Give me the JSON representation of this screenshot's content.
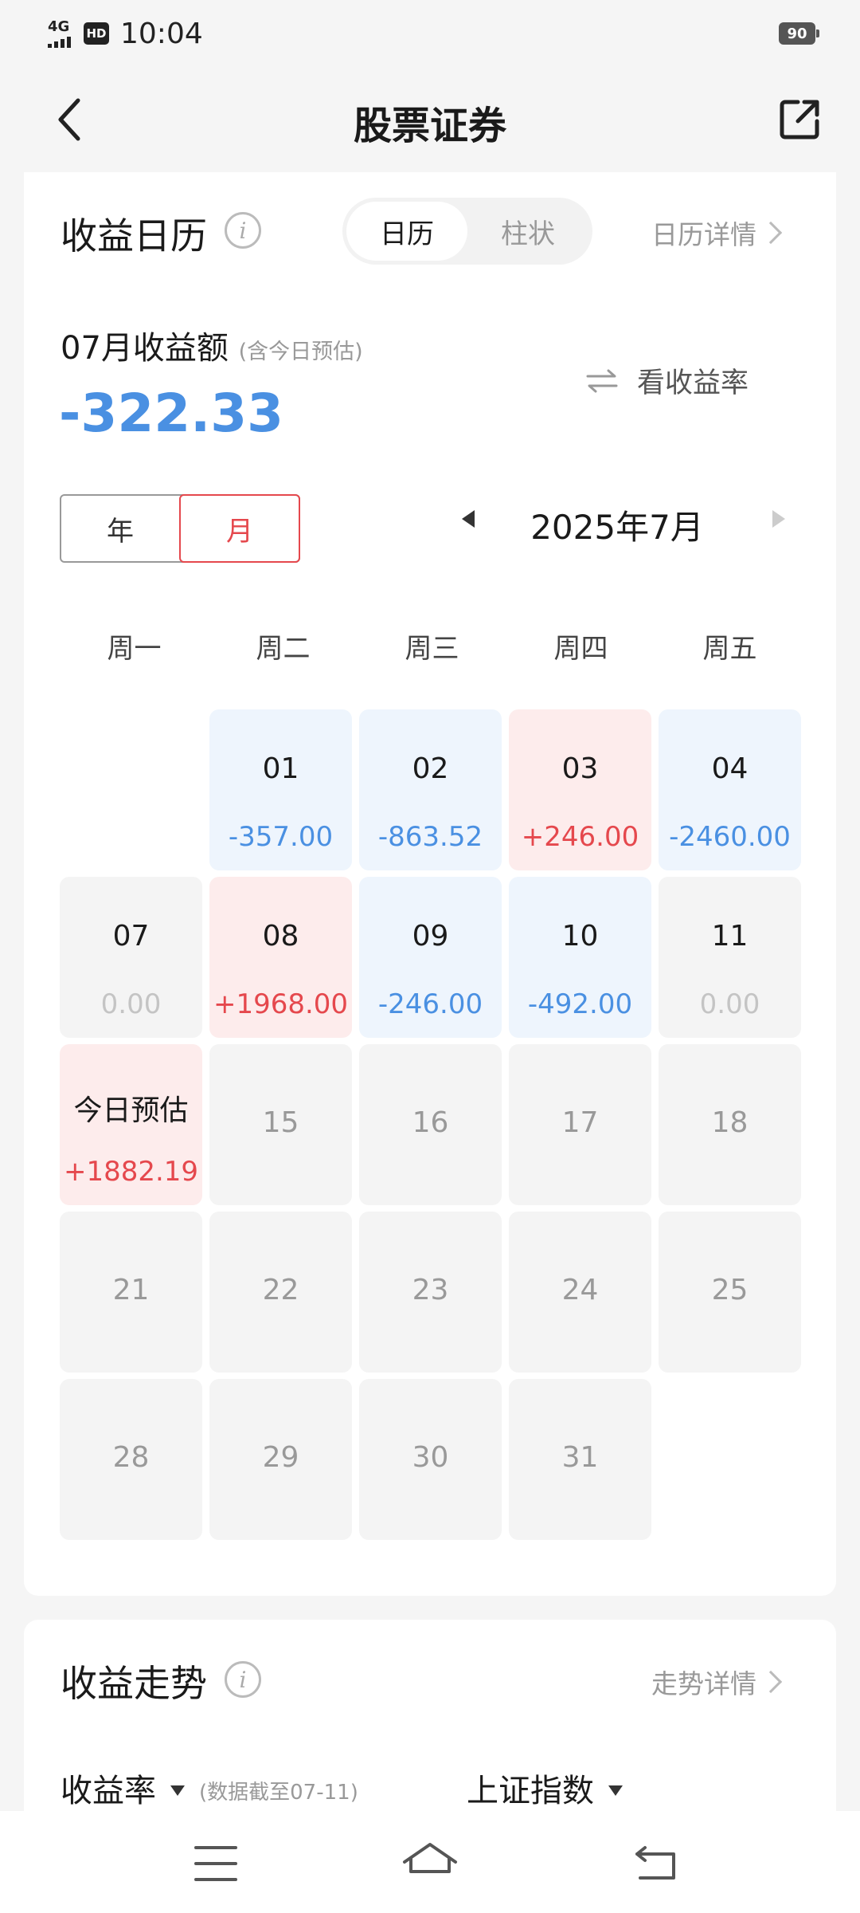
{
  "status": {
    "network": "4G",
    "hd": "HD",
    "time": "10:04",
    "battery": "90"
  },
  "nav": {
    "title": "股票证券"
  },
  "calendar_section": {
    "title": "收益日历",
    "info": "i",
    "tabs": [
      "日历",
      "柱状"
    ],
    "detail_link": "日历详情",
    "month_label": "07月收益额",
    "month_note": "(含今日预估)",
    "month_value": "-322.33",
    "toggle_label": "看收益率",
    "period_tabs": [
      "年",
      "月"
    ],
    "current_month": "2025年7月",
    "weekdays": [
      "周一",
      "周二",
      "周三",
      "周四",
      "周五"
    ],
    "rows": [
      [
        null,
        {
          "day": "01",
          "value": "-357.00",
          "kind": "blue"
        },
        {
          "day": "02",
          "value": "-863.52",
          "kind": "blue"
        },
        {
          "day": "03",
          "value": "+246.00",
          "kind": "red"
        },
        {
          "day": "04",
          "value": "-2460.00",
          "kind": "blue"
        }
      ],
      [
        {
          "day": "07",
          "value": "0.00",
          "kind": "gray"
        },
        {
          "day": "08",
          "value": "+1968.00",
          "kind": "red"
        },
        {
          "day": "09",
          "value": "-246.00",
          "kind": "blue"
        },
        {
          "day": "10",
          "value": "-492.00",
          "kind": "blue"
        },
        {
          "day": "11",
          "value": "0.00",
          "kind": "gray"
        }
      ],
      [
        {
          "day": "今日预估",
          "value": "+1882.19",
          "kind": "red"
        },
        {
          "day": "15",
          "kind": "future"
        },
        {
          "day": "16",
          "kind": "future"
        },
        {
          "day": "17",
          "kind": "future"
        },
        {
          "day": "18",
          "kind": "future"
        }
      ],
      [
        {
          "day": "21",
          "kind": "future"
        },
        {
          "day": "22",
          "kind": "future"
        },
        {
          "day": "23",
          "kind": "future"
        },
        {
          "day": "24",
          "kind": "future"
        },
        {
          "day": "25",
          "kind": "future"
        }
      ],
      [
        {
          "day": "28",
          "kind": "future"
        },
        {
          "day": "29",
          "kind": "future"
        },
        {
          "day": "30",
          "kind": "future"
        },
        {
          "day": "31",
          "kind": "future"
        },
        null
      ]
    ]
  },
  "trend_section": {
    "title": "收益走势",
    "info": "i",
    "detail_link": "走势详情",
    "metric": "收益率",
    "note": "(数据截至07-11)",
    "index": "上证指数"
  },
  "colors": {
    "negative": "#4a90e2",
    "positive": "#e5484d",
    "neutral": "#c4c4c4"
  }
}
